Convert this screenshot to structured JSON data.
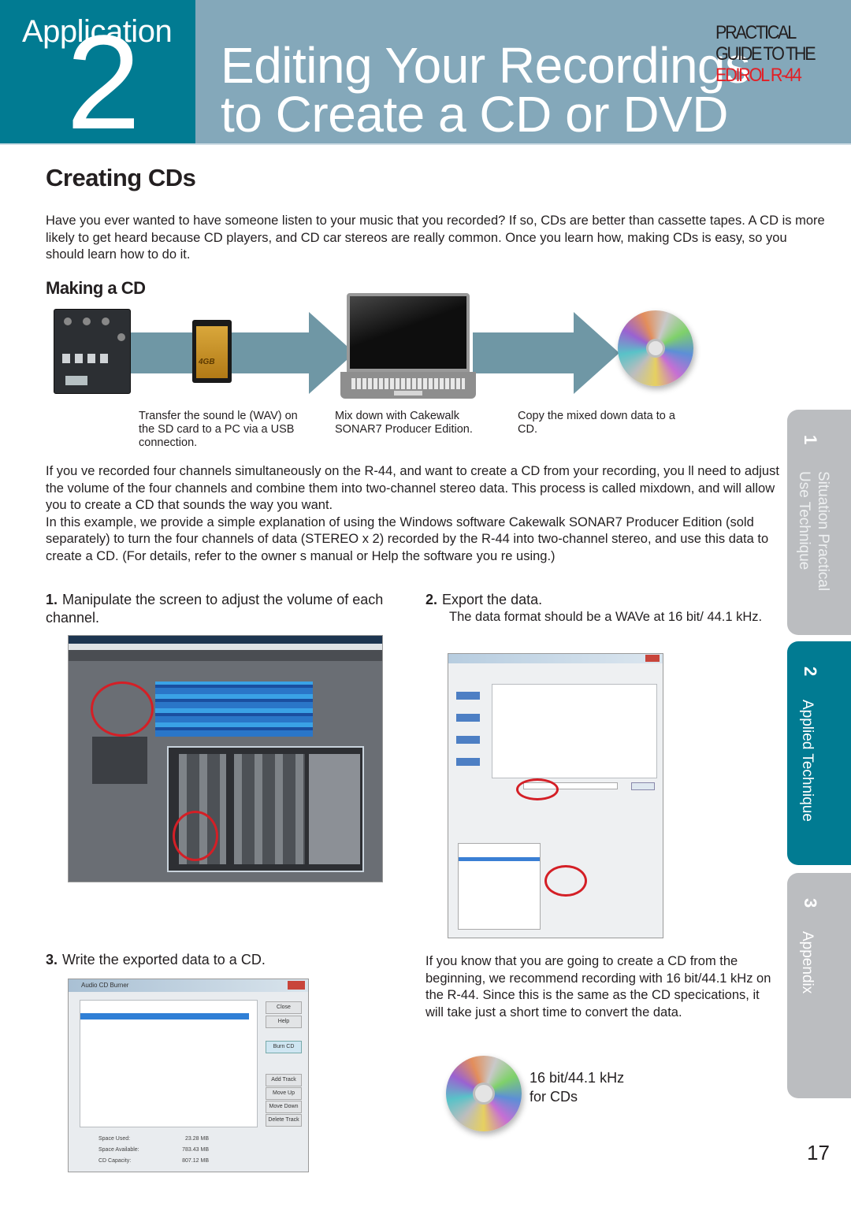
{
  "header": {
    "section_label": "Application",
    "section_number": "2",
    "title_line1": "Editing Your Recordings",
    "title_line2": "to Create a CD or DVD",
    "guide_line1": "PRACTICAL",
    "guide_line2": "GUIDE TO THE",
    "guide_line3": "EDIROL R-44",
    "colors": {
      "section_bg": "#017b92",
      "title_bg": "#84a8ba",
      "guide_accent": "#e31e24"
    }
  },
  "main": {
    "heading": "Creating CDs",
    "intro": "Have you ever wanted to have someone listen to your music that you recorded? If so, CDs are better than cassette tapes. A CD is more likely to get heard because CD players, and CD car stereos are really common. Once you learn how, making CDs is easy, so you should learn how to do it.",
    "subheading": "Making a CD",
    "flow": {
      "items": [
        "R-44 recorder",
        "SD card 4GB",
        "laptop PC",
        "CD"
      ],
      "sd_label": "4GB",
      "captions": [
        "Transfer the sound le (WAV) on the SD card to a PC via a USB connection.",
        "Mix down with Cakewalk SONAR7 Producer Edition.",
        "Copy the mixed down data to a CD."
      ]
    },
    "mixdown_p1": "If you ve recorded four channels simultaneously on the R-44, and want to create a CD from your recording, you ll need to adjust the volume of the four channels and combine them into two-channel stereo data. This process is called  mixdown, and will allow you to create a CD that sounds the way you want.",
    "mixdown_p2": "In this example, we provide a simple explanation of using the Windows software  Cakewalk SONAR7 Producer Edition  (sold separately) to turn the four channels of data (STEREO x 2) recorded by the R-44 into two-channel stereo, and use this data to create a CD. (For details, refer to the owner s manual or Help the software you re using.)",
    "steps": [
      {
        "num": "1.",
        "text": "Manipulate the screen to adjust the volume of each channel.",
        "sub": ""
      },
      {
        "num": "2.",
        "text": "Export the data.",
        "sub": "The data format should be a WAVe at 16 bit/ 44.1 kHz."
      },
      {
        "num": "3.",
        "text": "Write the exported data to a CD.",
        "sub": ""
      }
    ],
    "tip": "If you know that you are going to create a CD from the beginning, we recommend recording with 16 bit/44.1 kHz on the R-44. Since this is the same as the CD specications, it will take just a short time to convert the data.",
    "cd_note_line1": "16 bit/44.1 kHz",
    "cd_note_line2": "for CDs",
    "screenshots": {
      "sonar": "Cakewalk SONAR mixer screen",
      "export": "Export Audio dialog",
      "burner_title": "Audio CD Burner",
      "burner_buttons": [
        "Close",
        "Help",
        "Burn CD",
        "Add Track",
        "Move Up",
        "Move Down",
        "Delete Track"
      ],
      "burner_stats": [
        {
          "label": "Space Used:",
          "value": "23.28 MB"
        },
        {
          "label": "Space Available:",
          "value": "783.43 MB"
        },
        {
          "label": "CD Capacity:",
          "value": "807.12 MB"
        }
      ]
    }
  },
  "side_tabs": [
    {
      "num": "1",
      "line1": "Situation Practical",
      "line2": "Use Technique",
      "active": false
    },
    {
      "num": "2",
      "line1": "Applied Technique",
      "line2": "",
      "active": true
    },
    {
      "num": "3",
      "line1": "Appendix",
      "line2": "",
      "active": false
    }
  ],
  "page_number": "17"
}
